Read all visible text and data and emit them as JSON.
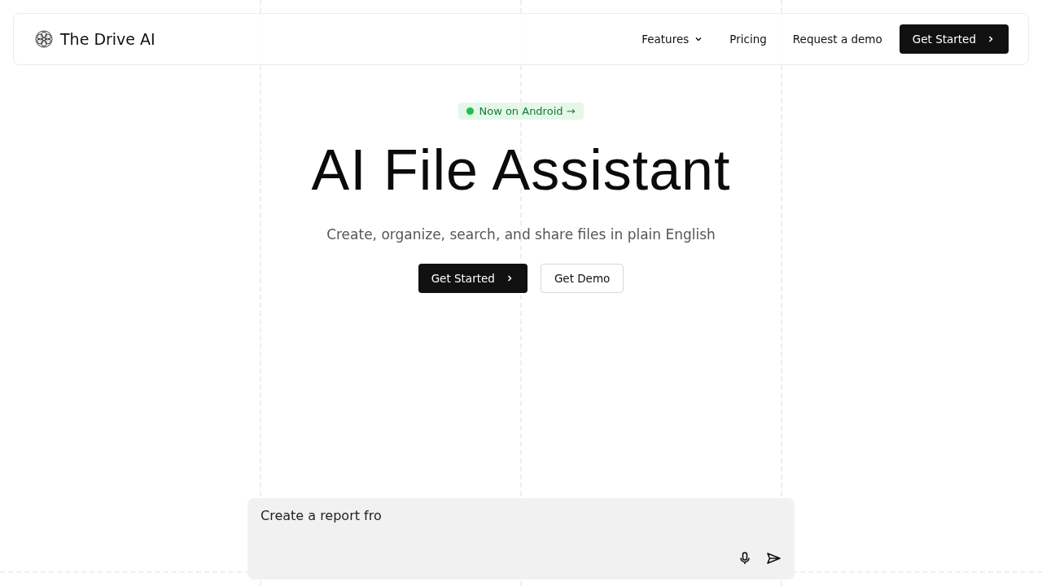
{
  "header": {
    "brand": "The Drive AI",
    "nav": [
      {
        "label": "Features",
        "kind": "dropdown"
      },
      {
        "label": "Pricing",
        "kind": "link"
      },
      {
        "label": "Request a demo",
        "kind": "link"
      }
    ],
    "cta": "Get Started"
  },
  "hero": {
    "badge": "Now on Android →",
    "title": "AI File Assistant",
    "subtitle": "Create, organize, search, and share files in plain English",
    "buttons": [
      {
        "label": "Get Started",
        "kind": "primary"
      },
      {
        "label": "Get Demo",
        "kind": "secondary"
      }
    ]
  },
  "prompt": {
    "value": "Create a report fro"
  }
}
